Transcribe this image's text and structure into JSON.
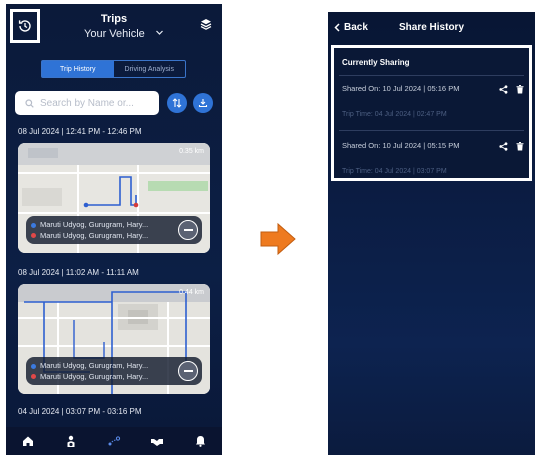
{
  "left": {
    "title": "Trips",
    "subtitle": "Your Vehicle",
    "tabs": [
      "Trip History",
      "Driving Analysis"
    ],
    "search_placeholder": "Search by Name or...",
    "trips": [
      {
        "header": "08 Jul 2024 | 12:41 PM - 12:46 PM",
        "distance": "0.35 km",
        "from": "Maruti Udyog, Gurugram, Hary...",
        "to": "Maruti Udyog, Gurugram, Hary..."
      },
      {
        "header": "08 Jul 2024 | 11:02 AM - 11:11 AM",
        "distance": "0.44 km",
        "from": "Maruti Udyog, Gurugram, Hary...",
        "to": "Maruti Udyog, Gurugram, Hary..."
      },
      {
        "header": "04 Jul 2024 | 03:07 PM - 03:16 PM"
      }
    ],
    "nav": [
      "home-icon",
      "driver-icon",
      "route-icon",
      "handshake-icon",
      "bell-icon"
    ]
  },
  "right": {
    "back_label": "Back",
    "title": "Share History",
    "section_label": "Currently Sharing",
    "entries": [
      {
        "shared_on": "Shared On: 10 Jul 2024 | 05:16 PM",
        "trip_time": "Trip Time: 04 Jul 2024 | 02:47 PM"
      },
      {
        "shared_on": "Shared On: 10 Jul 2024 | 05:15 PM",
        "trip_time": "Trip Time: 04 Jul 2024 | 03:07 PM"
      }
    ]
  },
  "colors": {
    "accent": "#2f73d6",
    "arrow": "#ee7a1f",
    "background_dark": "#0b1a3a"
  }
}
